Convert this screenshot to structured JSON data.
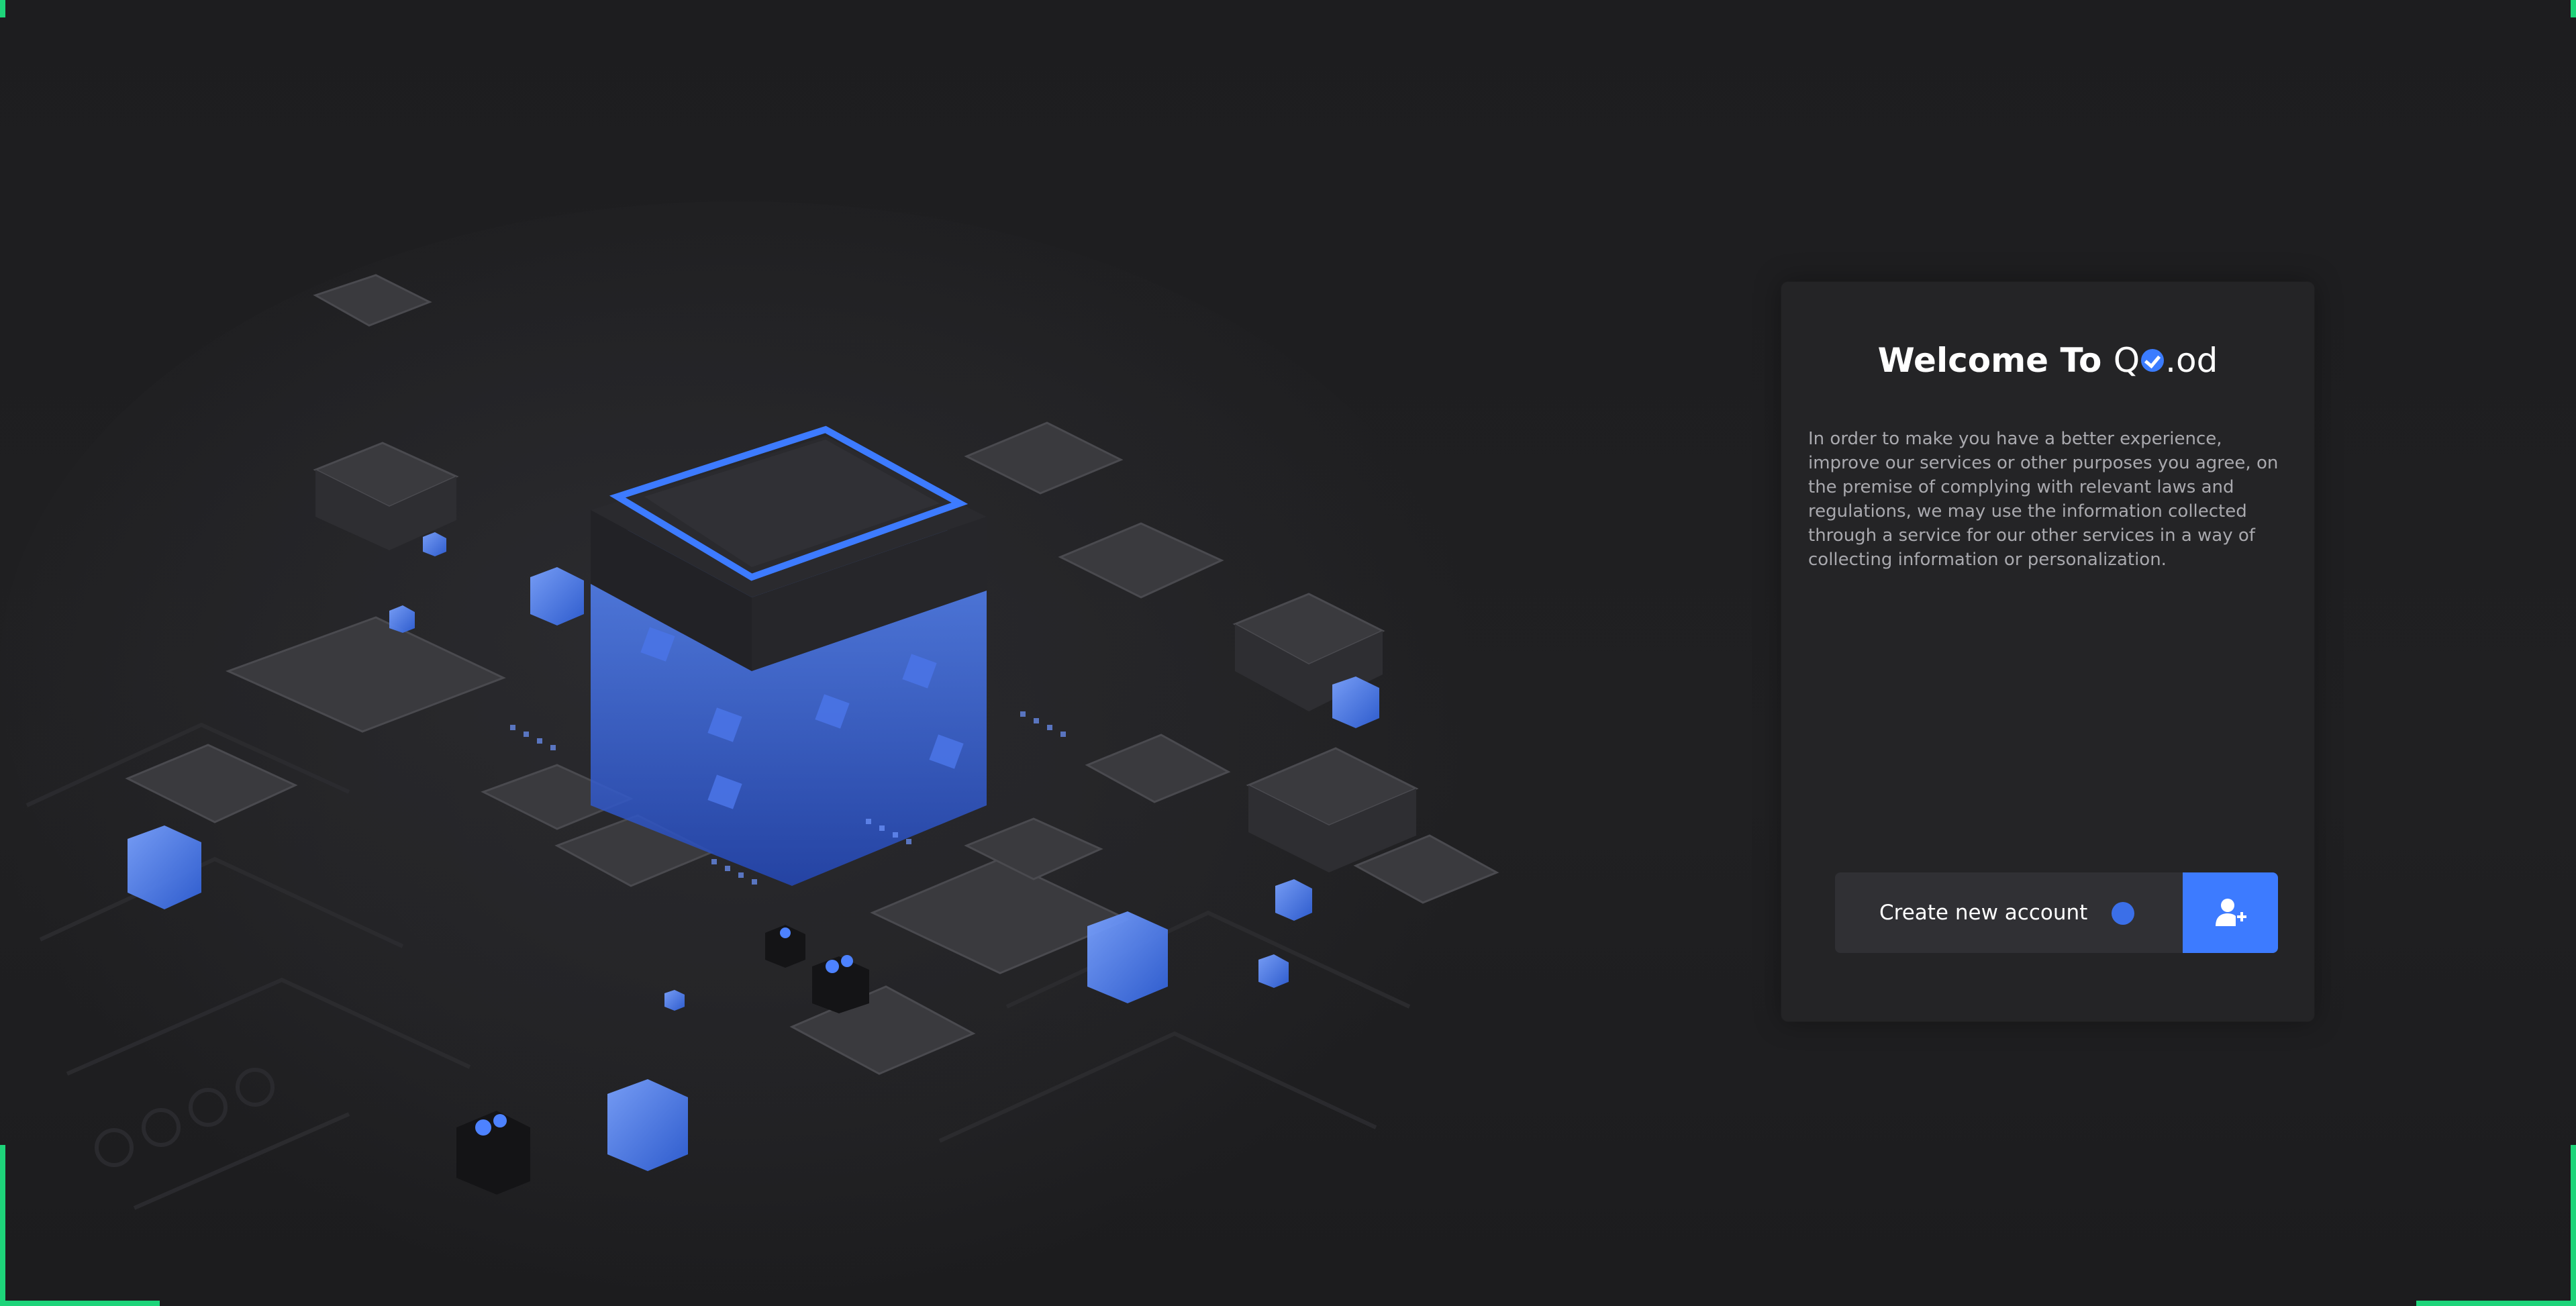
{
  "colors": {
    "background": "#1f1f21",
    "card": "#242426",
    "accent": "#3d7bff",
    "corner_accent": "#1ed47a"
  },
  "card": {
    "title_prefix": "Welcome To ",
    "brand_left": "Q",
    "brand_right": ".od",
    "brand_icon": "check-circle-icon",
    "body": "In order to make you have a better experience, improve our services or other purposes you agree, on the premise of complying with relevant laws and regulations, we may use the information collected through a service for our other services in a way of collecting information or personalization."
  },
  "cta": {
    "label": "Create new account",
    "icon": "add-user-icon"
  },
  "hero": {
    "icon": "circuit-chip-illustration"
  }
}
